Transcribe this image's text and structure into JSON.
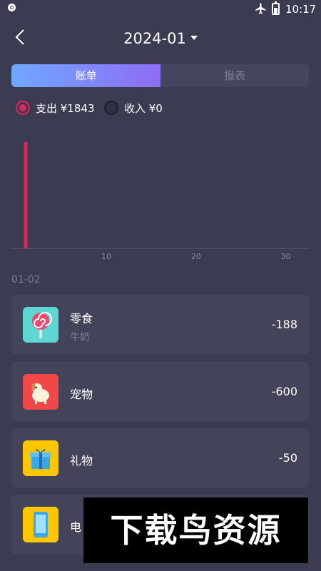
{
  "status_bar": {
    "time": "10:17"
  },
  "header": {
    "title": "2024-01"
  },
  "tabs": [
    {
      "label": "账单",
      "active": true
    },
    {
      "label": "报表",
      "active": false
    }
  ],
  "filters": [
    {
      "label": "支出 ¥1843",
      "selected": true
    },
    {
      "label": "收入 ¥0",
      "selected": false
    }
  ],
  "chart_data": {
    "type": "bar",
    "x": [
      1
    ],
    "values": [
      1843
    ],
    "xlim": [
      1,
      31
    ],
    "xticks": [
      "10",
      "20",
      "30"
    ],
    "grid": false,
    "bar_color": "#e0255e"
  },
  "section_date": "01-02",
  "transactions": [
    {
      "name": "零食",
      "note": "牛奶",
      "amount": "-188",
      "icon": "lollipop-icon",
      "icon_color": "#5ed6d1"
    },
    {
      "name": "宠物",
      "note": "",
      "amount": "-600",
      "icon": "pet-dog-icon",
      "icon_color": "#f04848"
    },
    {
      "name": "礼物",
      "note": "",
      "amount": "-50",
      "icon": "gift-box-icon",
      "icon_color": "#ffc600"
    },
    {
      "name": "电",
      "note": "",
      "amount": "",
      "icon": "phone-icon",
      "icon_color": "#ffc600"
    }
  ],
  "watermark": "下载鸟资源",
  "colors": {
    "accent": "#e0255e",
    "background": "#3b3b52",
    "card": "#43435a",
    "tab_gradient_start": "#6fa8ff",
    "tab_gradient_end": "#8e6cf5"
  }
}
